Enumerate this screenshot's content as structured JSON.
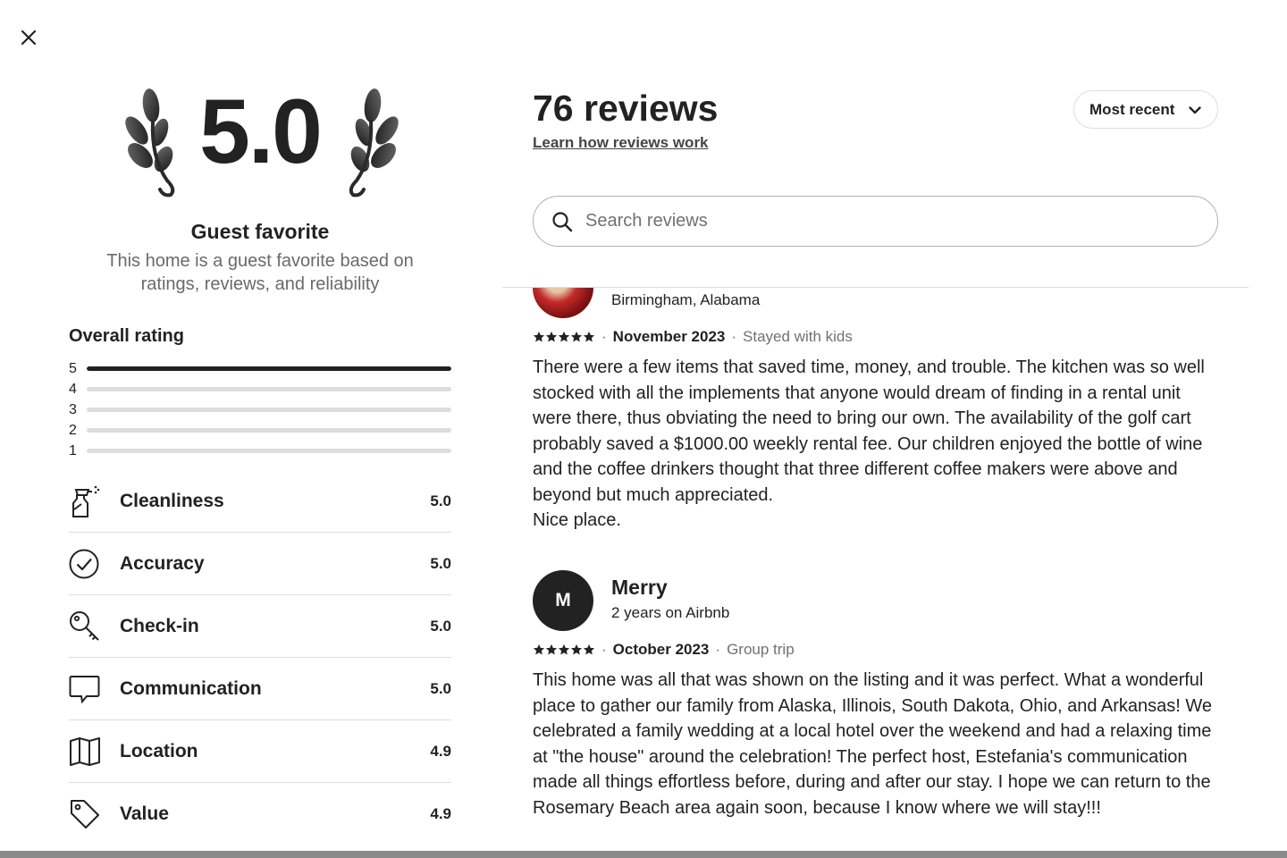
{
  "modal": {
    "close_icon": "close-icon"
  },
  "summary": {
    "rating": "5.0",
    "guest_favorite_title": "Guest favorite",
    "guest_favorite_desc": "This home is a guest favorite based on ratings, reviews, and reliability",
    "overall_title": "Overall rating",
    "histogram": [
      {
        "stars": "5",
        "fraction": 1.0
      },
      {
        "stars": "4",
        "fraction": 0.0
      },
      {
        "stars": "3",
        "fraction": 0.0
      },
      {
        "stars": "2",
        "fraction": 0.0
      },
      {
        "stars": "1",
        "fraction": 0.0
      }
    ],
    "categories": [
      {
        "label": "Cleanliness",
        "value": "5.0",
        "icon": "spray-bottle-icon"
      },
      {
        "label": "Accuracy",
        "value": "5.0",
        "icon": "check-circle-icon"
      },
      {
        "label": "Check-in",
        "value": "5.0",
        "icon": "key-icon"
      },
      {
        "label": "Communication",
        "value": "5.0",
        "icon": "chat-bubble-icon"
      },
      {
        "label": "Location",
        "value": "4.9",
        "icon": "map-icon"
      },
      {
        "label": "Value",
        "value": "4.9",
        "icon": "price-tag-icon"
      }
    ]
  },
  "reviews_panel": {
    "title": "76 reviews",
    "learn_link": "Learn how reviews work",
    "sort_label": "Most recent",
    "search_placeholder": "Search reviews",
    "reviews": [
      {
        "initial": "",
        "name": "",
        "sub": "Birmingham, Alabama",
        "stars": 5,
        "date": "November 2023",
        "trip": "Stayed with kids",
        "text": "There were a few items that saved time, money, and trouble. The kitchen was so well stocked with all the implements that anyone would dream of finding in a rental unit were there, thus obviating the need to bring our own. The availability of the golf cart probably saved a $1000.00 weekly rental fee. Our children enjoyed the bottle of wine and the coffee drinkers thought that three different coffee makers were above and beyond but much appreciated.\nNice place."
      },
      {
        "initial": "M",
        "name": "Merry",
        "sub": "2 years on Airbnb",
        "stars": 5,
        "date": "October 2023",
        "trip": "Group trip",
        "text": "This home was all that was shown on the listing and it was perfect. What a wonderful place to gather our family from Alaska, Illinois, South Dakota, Ohio, and Arkansas! We celebrated a family wedding at a local hotel over the weekend and had a relaxing time at \"the house\" around the celebration! The perfect host, Estefania's communication made all things effortless before, during and after our stay. I hope we can return to the Rosemary Beach area again soon, because I know where we will stay!!!"
      }
    ]
  },
  "colors": {
    "text": "#222222",
    "muted": "#717171",
    "divider": "#dddddd"
  }
}
